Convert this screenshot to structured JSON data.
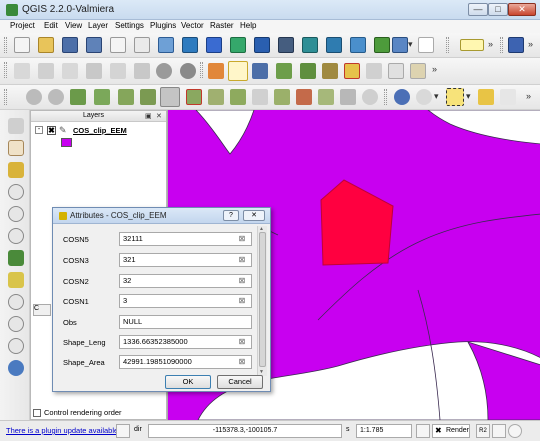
{
  "window": {
    "title": "QGIS 2.2.0-Valmiera",
    "minimize_glyph": "—",
    "maximize_glyph": "□",
    "close_glyph": "✕"
  },
  "menu": [
    "Project",
    "Edit",
    "View",
    "Layer",
    "Settings",
    "Plugins",
    "Vector",
    "Raster",
    "Help"
  ],
  "toolbar_chevron": "»",
  "toolbar_dropdown": "▾",
  "layers_panel": {
    "title": "Layers",
    "float_glyph": "▣",
    "close_glyph": "✕",
    "layer": {
      "name": "COS_clip_EEM",
      "expand_glyph": "-",
      "checked_glyph": "✖",
      "pencil_glyph": "✎",
      "fill_color": "#c800f0"
    },
    "collapsed_tab_label": "C",
    "control_rendering_order": "Control rendering order"
  },
  "attributes_dialog": {
    "title": "Attributes - COS_clip_EEM",
    "help_glyph": "?",
    "close_glyph": "✕",
    "clear_glyph": "⊠",
    "fields": [
      {
        "name": "COSN5",
        "value": "32111"
      },
      {
        "name": "COSN3",
        "value": "321"
      },
      {
        "name": "COSN2",
        "value": "32"
      },
      {
        "name": "COSN1",
        "value": "3"
      },
      {
        "name": "Obs",
        "value": "NULL"
      },
      {
        "name": "Shape_Leng",
        "value": "1336.66352385000"
      },
      {
        "name": "Shape_Area",
        "value": "42991.19851090000"
      }
    ],
    "ok_label": "OK",
    "cancel_label": "Cancel"
  },
  "map": {
    "polygon_color": "#c800f0",
    "selected_color": "#ff0040",
    "line_color": "#3a2a50"
  },
  "statusbar": {
    "plugin_update_link": "There is a plugin update available",
    "coord_label": "dir",
    "coordinates": "-115378.3,-100105.7",
    "scale_label": "s",
    "scale": "1:1.785",
    "render_label": "Render",
    "render_checked_glyph": "✖",
    "crs_glyph": "R2"
  }
}
